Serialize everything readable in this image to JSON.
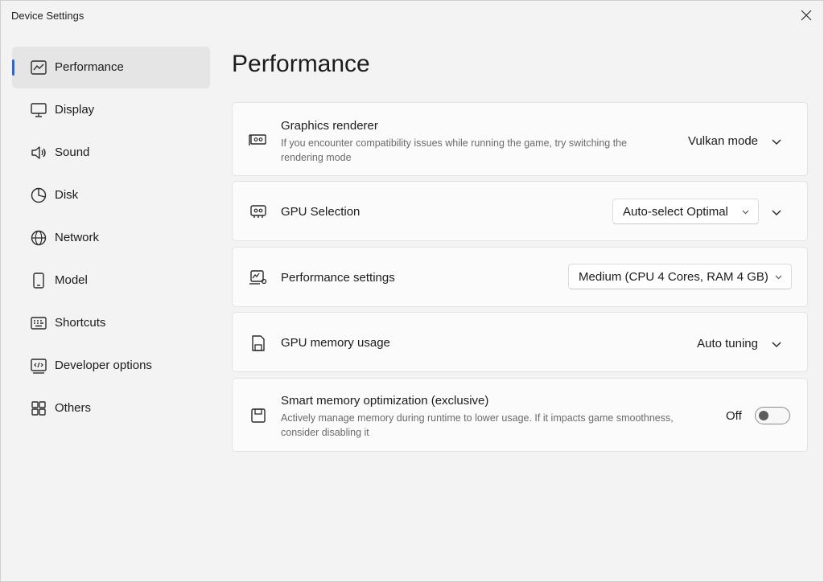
{
  "window": {
    "title": "Device Settings"
  },
  "sidebar": {
    "items": [
      {
        "label": "Performance",
        "icon": "chart-line-icon",
        "active": true
      },
      {
        "label": "Display",
        "icon": "monitor-icon",
        "active": false
      },
      {
        "label": "Sound",
        "icon": "speaker-icon",
        "active": false
      },
      {
        "label": "Disk",
        "icon": "pie-chart-icon",
        "active": false
      },
      {
        "label": "Network",
        "icon": "globe-icon",
        "active": false
      },
      {
        "label": "Model",
        "icon": "phone-icon",
        "active": false
      },
      {
        "label": "Shortcuts",
        "icon": "keyboard-icon",
        "active": false
      },
      {
        "label": "Developer options",
        "icon": "code-window-icon",
        "active": false
      },
      {
        "label": "Others",
        "icon": "grid-icon",
        "active": false
      }
    ]
  },
  "main": {
    "title": "Performance",
    "settings": [
      {
        "title": "Graphics renderer",
        "description": "If you encounter compatibility issues while running the game, try switching the rendering mode",
        "value": "Vulkan mode",
        "icon": "gpu-card-icon"
      },
      {
        "title": "GPU Selection",
        "value": "Auto-select Optimal",
        "icon": "gpu-chip-icon"
      },
      {
        "title": "Performance settings",
        "value": "Medium (CPU 4 Cores, RAM 4 GB)",
        "icon": "performance-gear-icon"
      },
      {
        "title": "GPU memory usage",
        "value": "Auto tuning",
        "icon": "memory-card-icon"
      },
      {
        "title": "Smart memory optimization (exclusive)",
        "description": "Actively manage memory during runtime to lower usage. If it impacts game smoothness, consider disabling it",
        "value": "Off",
        "toggle_on": false,
        "icon": "save-memory-icon"
      }
    ]
  },
  "colors": {
    "accent": "#2a66d6",
    "background": "#f3f3f3",
    "card": "#fbfbfb"
  }
}
